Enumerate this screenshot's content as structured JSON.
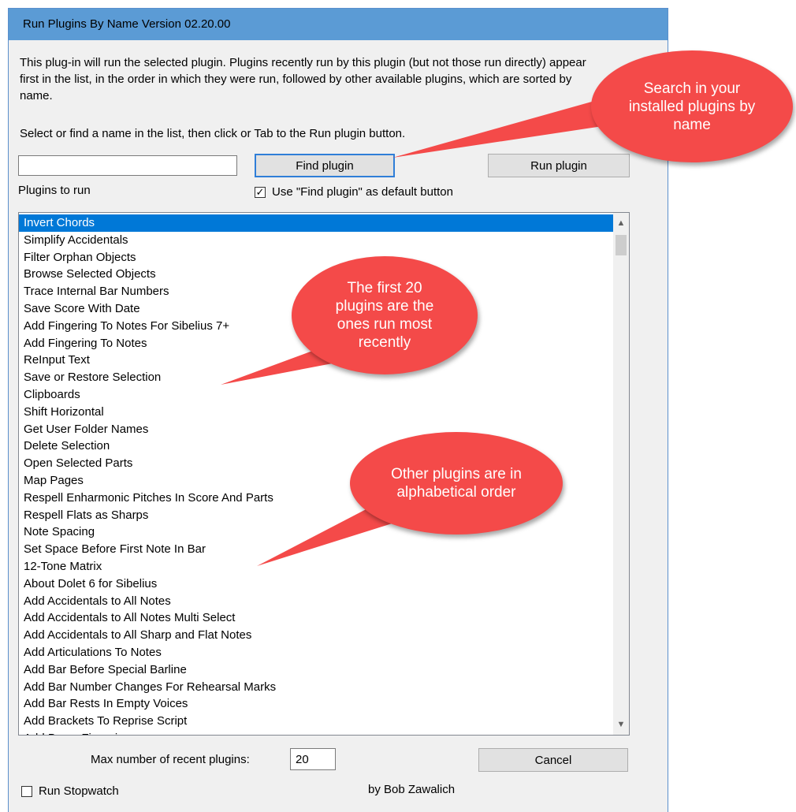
{
  "window": {
    "title": "Run Plugins By Name  Version 02.20.00"
  },
  "intro": {
    "text": "This plug-in will run the selected plugin. Plugins recently run by this plugin (but not those run directly) appear first in the list, in the order in which they were run, followed by other available plugins, which are sorted by name.",
    "instructions": "Select or find a name in the list, then click or Tab to the Run plugin button."
  },
  "search": {
    "value": "",
    "placeholder": ""
  },
  "buttons": {
    "find": "Find plugin",
    "run": "Run plugin",
    "cancel": "Cancel"
  },
  "labels": {
    "plugins_to_run": "Plugins to run",
    "max_recent": "Max number of recent plugins:",
    "author": "by Bob Zawalich"
  },
  "checkboxes": {
    "default_button": {
      "label": "Use \"Find plugin\" as default button",
      "checked": true,
      "mark": "✓"
    },
    "stopwatch": {
      "label": "Run Stopwatch",
      "checked": false,
      "mark": ""
    }
  },
  "max_recent_value": "20",
  "plugins": [
    "Invert Chords",
    "Simplify Accidentals",
    "Filter Orphan Objects",
    "Browse Selected Objects",
    "Trace Internal Bar Numbers",
    "Save Score With Date",
    "Add Fingering To Notes For Sibelius 7+",
    "Add Fingering To Notes",
    "ReInput Text",
    "Save or Restore Selection",
    "Clipboards",
    "Shift Horizontal",
    "Get User Folder Names",
    "Delete Selection",
    "Open Selected Parts",
    "Map Pages",
    "Respell Enharmonic Pitches In Score And Parts",
    "Respell Flats as Sharps",
    "Note Spacing",
    "Set Space Before First Note In Bar",
    "12-Tone Matrix",
    "About Dolet 6 for Sibelius",
    "Add Accidentals to All Notes",
    "Add Accidentals to All Notes Multi Select",
    "Add Accidentals to All Sharp and Flat Notes",
    "Add Articulations To Notes",
    "Add Bar Before Special Barline",
    "Add Bar Number Changes For Rehearsal Marks",
    "Add Bar Rests In Empty Voices",
    "Add Brackets To Reprise Script",
    "Add Brass Fingering"
  ],
  "selected_plugin_index": 0,
  "callouts": {
    "search": "Search in your installed plugins by name",
    "recent": "The first 20 plugins are the ones run most recently",
    "alpha": "Other plugins are in alphabetical order"
  },
  "colors": {
    "titlebar": "#5b9bd5",
    "selection": "#0078d7",
    "callout": "#f44a49",
    "focus_border": "#2f7ed8"
  }
}
